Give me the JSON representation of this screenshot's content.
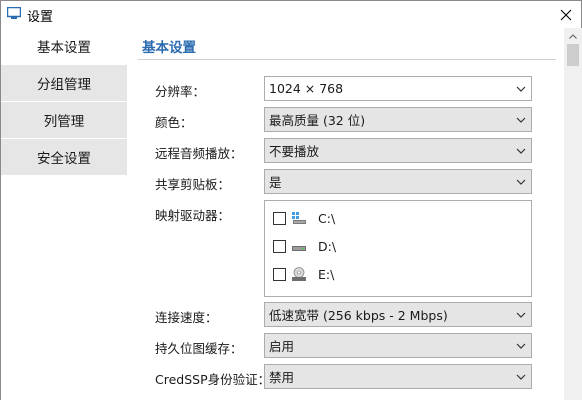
{
  "window": {
    "title": "设置",
    "icon": "app-window-icon"
  },
  "sidebar": {
    "items": [
      {
        "label": "基本设置",
        "active": true
      },
      {
        "label": "分组管理",
        "active": false
      },
      {
        "label": "列管理",
        "active": false
      },
      {
        "label": "安全设置",
        "active": false
      }
    ]
  },
  "main": {
    "section_title": "基本设置",
    "resolution": {
      "label": "分辨率：",
      "value": "1024 × 768"
    },
    "color": {
      "label": "颜色：",
      "value": "最高质量 (32 位)"
    },
    "remote_audio": {
      "label": "远程音频播放：",
      "value": "不要播放"
    },
    "clipboard": {
      "label": "共享剪贴板：",
      "value": "是"
    },
    "drives": {
      "label": "映射驱动器：",
      "items": [
        {
          "label": "C:\\",
          "checked": false,
          "icon": "system-drive-icon"
        },
        {
          "label": "D:\\",
          "checked": false,
          "icon": "hard-drive-icon"
        },
        {
          "label": "E:\\",
          "checked": false,
          "icon": "cd-drive-icon"
        }
      ]
    },
    "connection_speed": {
      "label": "连接速度：",
      "value": "低速宽带 (256 kbps - 2 Mbps)"
    },
    "bitmap_cache": {
      "label": "持久位图缓存：",
      "value": "启用"
    },
    "credssp": {
      "label": "CredSSP身份验证：",
      "value": "禁用"
    }
  },
  "colors": {
    "accent": "#2b6cb0",
    "nav_inactive": "#e6e6e6",
    "combo_gray": "#e5e5e5"
  }
}
